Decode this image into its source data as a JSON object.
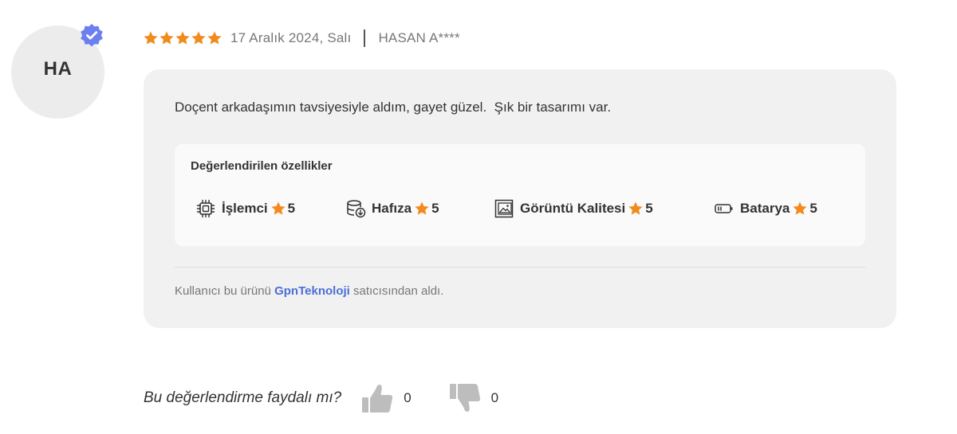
{
  "reviewer": {
    "initials": "HA",
    "name": "HASAN A****",
    "date": "17 Aralık 2024, Salı",
    "verified": true
  },
  "rating": {
    "stars": 5,
    "max": 5
  },
  "review": {
    "text": "Doçent arkadaşımın tavsiyesiyle aldım, gayet güzel.  Şık bir tasarımı var."
  },
  "features": {
    "title": "Değerlendirilen özellikler",
    "items": [
      {
        "label": "İşlemci",
        "score": "5",
        "icon": "cpu-chip-icon"
      },
      {
        "label": "Hafıza",
        "score": "5",
        "icon": "storage-database-icon"
      },
      {
        "label": "Görüntü Kalitesi",
        "score": "5",
        "icon": "image-quality-icon"
      },
      {
        "label": "Batarya",
        "score": "5",
        "icon": "battery-icon"
      }
    ]
  },
  "seller": {
    "prefix": "Kullanıcı bu ürünü ",
    "name": "GpnTeknoloji",
    "suffix": " satıcısından aldı."
  },
  "helpful": {
    "question": "Bu değerlendirme faydalı mı?",
    "up_count": "0",
    "down_count": "0"
  },
  "colors": {
    "star": "#f28a1d",
    "verified": "#6b7ff0",
    "seller_link": "#4b6fd6",
    "card_bg": "#f1f1f1",
    "avatar_bg": "#ececec",
    "vote_icon": "#bdbdbd"
  }
}
